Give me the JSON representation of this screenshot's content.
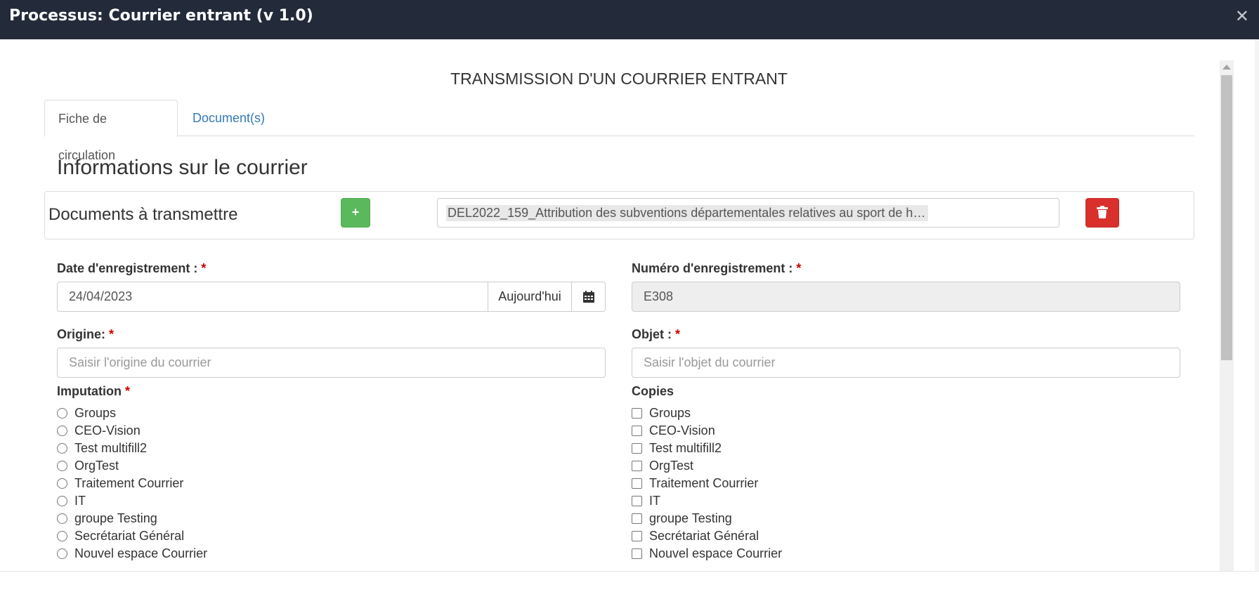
{
  "window": {
    "title": "Processus: Courrier entrant (v 1.0)",
    "close_glyph": "✕"
  },
  "form": {
    "heading": "TRANSMISSION D'UN COURRIER ENTRANT",
    "tabs": [
      {
        "label": "Fiche de circulation",
        "active": true
      },
      {
        "label": "Document(s)",
        "active": false
      }
    ],
    "section_title": "Informations sur le courrier",
    "documents": {
      "label": "Documents à transmettre",
      "add_glyph": "+",
      "file_name": "DEL2022_159_Attribution des subventions départementales relatives au sport de hau…",
      "delete_icon": "trash-icon"
    },
    "date": {
      "label": "Date d'enregistrement :",
      "required_mark": "*",
      "value": "24/04/2023",
      "today_button": "Aujourd'hui",
      "calendar_icon": "calendar-icon"
    },
    "number": {
      "label": "Numéro d'enregistrement :",
      "required_mark": "*",
      "value": "E308"
    },
    "origin": {
      "label": "Origine:",
      "required_mark": "*",
      "placeholder": "Saisir l'origine du courrier"
    },
    "object": {
      "label": "Objet :",
      "required_mark": "*",
      "placeholder": "Saisir l'objet du courrier"
    },
    "imputation": {
      "label": "Imputation",
      "required_mark": "*",
      "options": [
        "Groups",
        "CEO-Vision",
        "Test multifill2",
        "OrgTest",
        "Traitement Courrier",
        "IT",
        "groupe Testing",
        "Secrétariat Général",
        "Nouvel espace Courrier"
      ]
    },
    "copies": {
      "label": "Copies",
      "options": [
        "Groups",
        "CEO-Vision",
        "Test multifill2",
        "OrgTest",
        "Traitement Courrier",
        "IT",
        "groupe Testing",
        "Secrétariat Général",
        "Nouvel espace Courrier"
      ]
    }
  },
  "colors": {
    "titlebar": "#232b3a",
    "add_button": "#5cb85c",
    "delete_button": "#d9302c",
    "link": "#337ab7",
    "required": "#cc0000"
  }
}
